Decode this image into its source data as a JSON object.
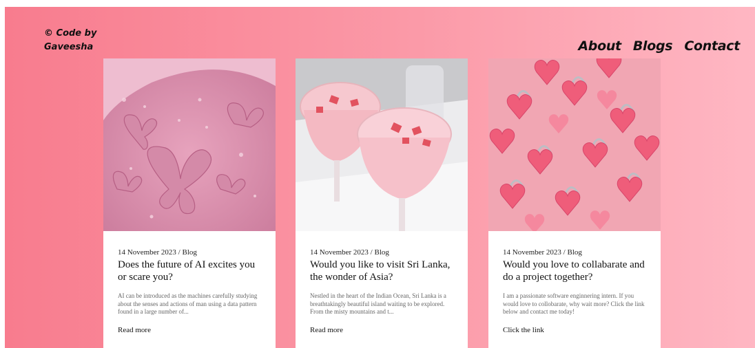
{
  "brand": {
    "line1": "© Code by",
    "line2": "Gaveesha"
  },
  "nav": {
    "items": [
      "About",
      "Blogs",
      "Contact"
    ]
  },
  "cards": [
    {
      "meta": "14 November 2023 / Blog",
      "title": "Does the future of AI excites you or scare you?",
      "excerpt": "AI can be introduced as the machines carefully studying about the senses and actions of man using a data pattern found in a large number of...",
      "link": "Read more"
    },
    {
      "meta": "14 November 2023 / Blog",
      "title": "Would you like to visit Sri Lanka, the wonder of Asia?",
      "excerpt": "Nestled in the heart of the Indian Ocean, Sri Lanka is a breathtakingly beautiful island waiting to be explored. From the misty mountains and t...",
      "link": "Read more"
    },
    {
      "meta": "14 November 2023 / Blog",
      "title": "Would you love to collabarate and do a project together?",
      "excerpt": "I am a passionate software enginnering intern. If you would love to collobarate, why wait more? Click the link below and contact me today!",
      "link": "Click the link"
    }
  ],
  "colors": {
    "gradient_start": "#f87c8e",
    "gradient_end": "#ffb7c3",
    "card_bg": "#ffffff"
  }
}
